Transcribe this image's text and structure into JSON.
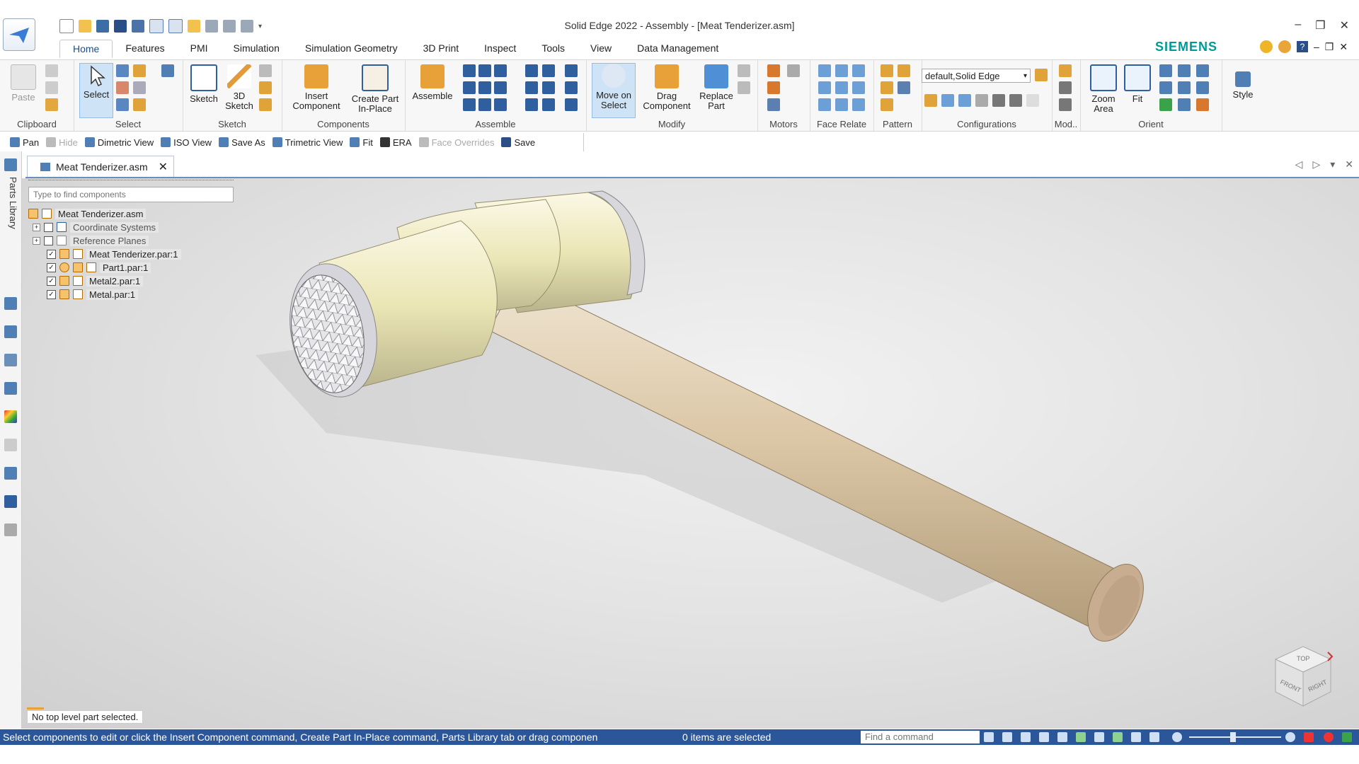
{
  "window": {
    "title": "Solid Edge 2022 - Assembly - [Meat Tenderizer.asm]",
    "brand": "SIEMENS"
  },
  "tabs": [
    "Home",
    "Features",
    "PMI",
    "Simulation",
    "Simulation Geometry",
    "3D Print",
    "Inspect",
    "Tools",
    "View",
    "Data Management"
  ],
  "ribbon": {
    "clipboard": {
      "paste": "Paste",
      "label": "Clipboard"
    },
    "select": {
      "button": "Select",
      "label": "Select"
    },
    "sketch": {
      "sketch": "Sketch",
      "sketch3d_1": "3D",
      "sketch3d_2": "Sketch",
      "label": "Sketch"
    },
    "components": {
      "insert_1": "Insert",
      "insert_2": "Component",
      "create_1": "Create Part",
      "create_2": "In-Place",
      "label": "Components"
    },
    "assemble": {
      "assemble": "Assemble",
      "label": "Assemble"
    },
    "modify": {
      "move_1": "Move on",
      "move_2": "Select",
      "drag_1": "Drag",
      "drag_2": "Component",
      "replace_1": "Replace",
      "replace_2": "Part",
      "label": "Modify"
    },
    "motors": {
      "label": "Motors"
    },
    "face_relate": {
      "label": "Face Relate"
    },
    "pattern": {
      "label": "Pattern"
    },
    "configurations": {
      "dropdown": "default,Solid Edge",
      "label": "Configurations"
    },
    "mod": {
      "label": "Mod.."
    },
    "orient": {
      "zoom_1": "Zoom",
      "zoom_2": "Area",
      "fit": "Fit",
      "label": "Orient"
    },
    "style": {
      "label": "Style"
    }
  },
  "quick_bar": [
    {
      "label": "Pan",
      "enabled": true
    },
    {
      "label": "Hide",
      "enabled": false
    },
    {
      "label": "Dimetric View",
      "enabled": true
    },
    {
      "label": "ISO View",
      "enabled": true
    },
    {
      "label": "Save As",
      "enabled": true
    },
    {
      "label": "Trimetric View",
      "enabled": true
    },
    {
      "label": "Fit",
      "enabled": true
    },
    {
      "label": "ERA",
      "enabled": true
    },
    {
      "label": "Face Overrides",
      "enabled": false
    },
    {
      "label": "Save",
      "enabled": true
    }
  ],
  "document_tab": {
    "name": "Meat Tenderizer.asm"
  },
  "sidebar": {
    "parts_library": "Parts Library"
  },
  "pathfinder": {
    "search_placeholder": "Type to find components",
    "items": [
      {
        "label": "Meat Tenderizer.asm",
        "level": 0
      },
      {
        "label": "Coordinate Systems",
        "level": 1
      },
      {
        "label": "Reference Planes",
        "level": 1
      },
      {
        "label": "Meat Tenderizer.par:1",
        "level": 1
      },
      {
        "label": "Part1.par:1",
        "level": 1
      },
      {
        "label": "Metal2.par:1",
        "level": 1
      },
      {
        "label": "Metal.par:1",
        "level": 1
      }
    ]
  },
  "viewport": {
    "status_message": "No top level part selected."
  },
  "view_cube": {
    "top": "TOP",
    "front": "FRONT",
    "right": "RIGHT"
  },
  "status_bar": {
    "prompt": "Select components to edit or click the Insert Component command, Create Part In-Place command, Parts Library tab or drag componen",
    "selection": "0 items are selected",
    "find_placeholder": "Find a command"
  },
  "colors": {
    "accent": "#2b579a",
    "brand": "#009999",
    "handle": "#d8c4a2",
    "head": "#ebe6b5",
    "metal": "#d8d8de"
  }
}
